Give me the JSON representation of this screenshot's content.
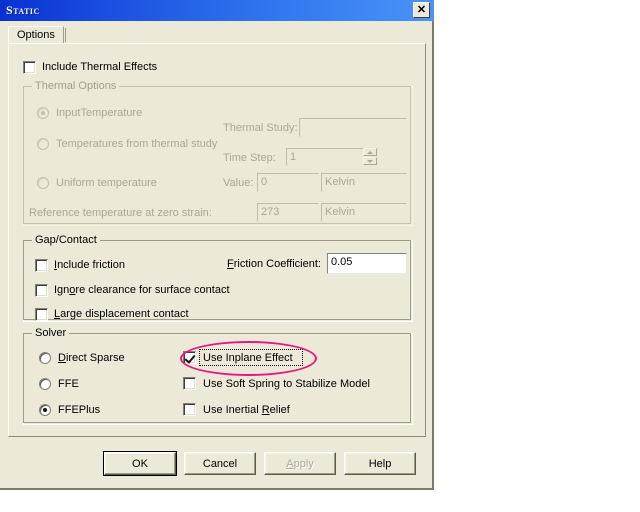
{
  "window": {
    "title": "Static",
    "close_label": "✕"
  },
  "tabs": [
    {
      "label": "Options"
    }
  ],
  "thermal": {
    "include_checkbox_label": "Include Thermal Effects",
    "include_checked": false,
    "group_title": "Thermal Options",
    "radio_input_temperature": "InputTemperature",
    "radio_from_study": "Temperatures from thermal study",
    "radio_uniform": "Uniform temperature",
    "thermal_study_label": "Thermal Study:",
    "thermal_study_value": "",
    "time_step_label": "Time Step:",
    "time_step_value": "1",
    "value_label": "Value:",
    "value_value": "0",
    "value_unit": "Kelvin",
    "reference_label": "Reference temperature at zero strain:",
    "reference_value": "273",
    "reference_unit": "Kelvin"
  },
  "gap_contact": {
    "group_title": "Gap/Contact",
    "include_friction": "Include friction",
    "include_friction_checked": false,
    "ignore_clearance": "Ignore clearance for surface contact",
    "ignore_clearance_checked": false,
    "large_displacement": "Large displacement contact",
    "large_displacement_checked": false,
    "friction_coefficient_label": "Friction Coefficient:",
    "friction_coefficient_value": "0.05"
  },
  "solver": {
    "group_title": "Solver",
    "radio_direct_sparse": "Direct Sparse",
    "radio_ffe": "FFE",
    "radio_ffeplus": "FFEPlus",
    "selected_radio": "FFEPlus",
    "use_inplane_effect": "Use Inplane Effect",
    "use_inplane_effect_checked": true,
    "use_soft_spring": "Use Soft Spring to Stabilize Model",
    "use_soft_spring_checked": false,
    "use_inertial_relief": "Use Inertial Relief",
    "use_inertial_relief_checked": false
  },
  "buttons": {
    "ok": "OK",
    "cancel": "Cancel",
    "apply": "Apply",
    "help": "Help"
  },
  "annotation": {
    "shape": "ellipse",
    "color": "#e6187f",
    "targets": "Use Inplane Effect"
  }
}
